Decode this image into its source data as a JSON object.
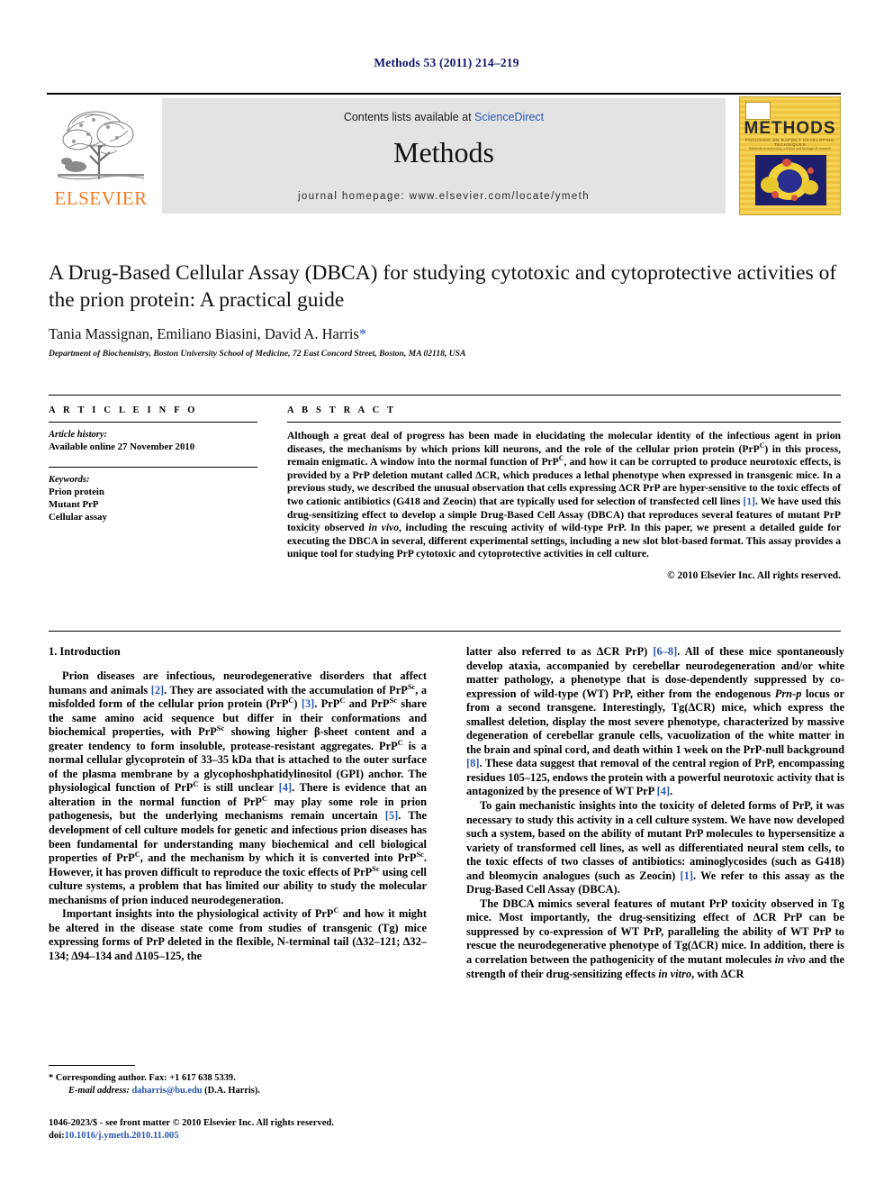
{
  "running_head": "Methods 53 (2011) 214–219",
  "masthead": {
    "publisher_name": "ELSEVIER",
    "contents_prefix": "Contents lists available at",
    "contents_link": "ScienceDirect",
    "journal_name": "Methods",
    "homepage": "journal homepage: www.elsevier.com/locate/ymeth",
    "cover": {
      "title": "METHODS",
      "subtitle": "FOCUSING ON RAPIDLY DEVELOPING TECHNIQUES",
      "subtitle2": "Methods in molecular, cellular and biological research"
    }
  },
  "article": {
    "title": "A Drug-Based Cellular Assay (DBCA) for studying cytotoxic and cytoprotective activities of the prion protein: A practical guide",
    "authors": "Tania Massignan, Emiliano Biasini, David A. Harris",
    "corresponding_marker": "*",
    "affiliation": "Department of Biochemistry, Boston University School of Medicine, 72 East Concord Street, Boston, MA 02118, USA"
  },
  "article_info": {
    "heading": "A R T I C L E  I N F O",
    "history_label": "Article history:",
    "history_value": "Available online 27 November 2010",
    "keywords_label": "Keywords:",
    "keywords": [
      "Prion protein",
      "Mutant PrP",
      "Cellular assay"
    ]
  },
  "abstract": {
    "heading": "A B S T R A C T",
    "copyright": "© 2010 Elsevier Inc. All rights reserved."
  },
  "body": {
    "section_heading": "1. Introduction"
  },
  "footnote": {
    "corresponding": "* Corresponding author. Fax: +1 617 638 5339.",
    "email_label": "E-mail address:",
    "email": "daharris@bu.edu",
    "email_owner": "(D.A. Harris)."
  },
  "footer": {
    "issn_line": "1046-2023/$ - see front matter © 2010 Elsevier Inc. All rights reserved.",
    "doi_label": "doi:",
    "doi": "10.1016/j.ymeth.2010.11.005"
  },
  "colors": {
    "link_blue": "#2b56b5",
    "heading_navy": "#12166b",
    "elsevier_orange": "#F47B20",
    "band_gray": "#e3e3e3",
    "cover_yellow": "#f2c94c"
  }
}
